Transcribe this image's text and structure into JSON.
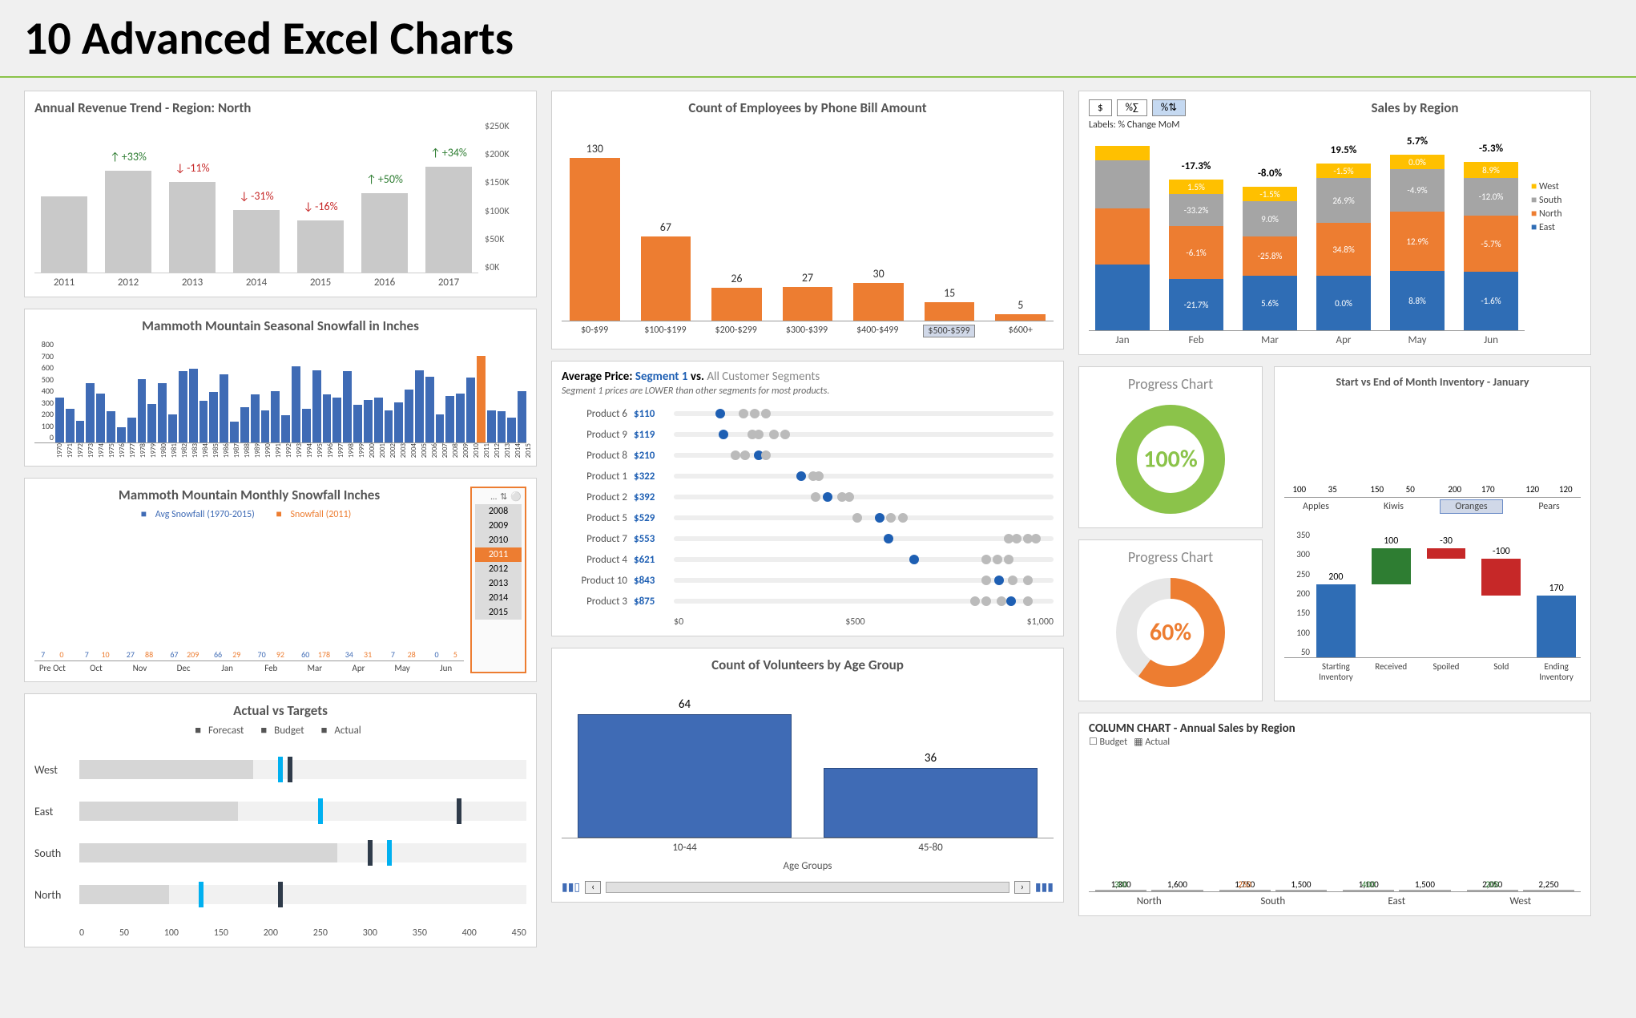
{
  "title": "10 Advanced Excel Charts",
  "chart_data": [
    {
      "id": "annual_revenue",
      "type": "bar",
      "title": "Annual Revenue Trend - Region: North",
      "categories": [
        "2011",
        "2012",
        "2013",
        "2014",
        "2015",
        "2016",
        "2017"
      ],
      "values": [
        150000,
        200000,
        178000,
        123000,
        103000,
        155000,
        208000
      ],
      "change_labels": [
        "",
        "+33%",
        "-11%",
        "-31%",
        "-16%",
        "+50%",
        "+34%"
      ],
      "ylim": [
        0,
        250000
      ],
      "yticks": [
        "$250K",
        "$200K",
        "$150K",
        "$100K",
        "$50K",
        "$0K"
      ]
    },
    {
      "id": "seasonal_snowfall",
      "type": "bar",
      "title": "Mammoth Mountain Seasonal Snowfall in Inches",
      "categories": [
        "1970",
        "1971",
        "1972",
        "1973",
        "1974",
        "1975",
        "1976",
        "1977",
        "1978",
        "1979",
        "1980",
        "1981",
        "1982",
        "1983",
        "1984",
        "1985",
        "1986",
        "1987",
        "1988",
        "1989",
        "1990",
        "1991",
        "1992",
        "1993",
        "1994",
        "1995",
        "1996",
        "1997",
        "1998",
        "1999",
        "2000",
        "2001",
        "2002",
        "2003",
        "2004",
        "2005",
        "2006",
        "2007",
        "2008",
        "2009",
        "2010",
        "2011",
        "2012",
        "2013",
        "2014",
        "2015"
      ],
      "values": [
        350,
        260,
        170,
        460,
        380,
        240,
        120,
        190,
        490,
        300,
        460,
        220,
        550,
        570,
        320,
        390,
        530,
        160,
        270,
        370,
        250,
        400,
        210,
        590,
        260,
        560,
        370,
        350,
        550,
        290,
        330,
        350,
        250,
        310,
        410,
        560,
        510,
        220,
        360,
        380,
        500,
        670,
        250,
        240,
        190,
        400
      ],
      "highlight_index": 41,
      "ylim": [
        0,
        800
      ],
      "yticks": [
        "800",
        "700",
        "600",
        "500",
        "400",
        "300",
        "200",
        "100",
        "0"
      ]
    },
    {
      "id": "monthly_snowfall",
      "type": "bar",
      "title": "Mammoth Mountain Monthly Snowfall Inches",
      "legend": [
        "Avg Snowfall (1970-2015)",
        "Snowfall (2011)"
      ],
      "categories": [
        "Pre Oct",
        "Oct",
        "Nov",
        "Dec",
        "Jan",
        "Feb",
        "Mar",
        "Apr",
        "May",
        "Jun"
      ],
      "series": [
        {
          "name": "Avg Snowfall (1970-2015)",
          "values": [
            7,
            7,
            27,
            67,
            66,
            70,
            60,
            34,
            7,
            0
          ]
        },
        {
          "name": "Snowfall (2011)",
          "values": [
            0,
            10,
            88,
            209,
            29,
            92,
            178,
            31,
            28,
            5
          ]
        }
      ],
      "slicer": {
        "years": [
          "2008",
          "2009",
          "2010",
          "2011",
          "2012",
          "2013",
          "2014",
          "2015"
        ],
        "selected": "2011",
        "icons": [
          "…",
          "⇅",
          "⚪"
        ]
      }
    },
    {
      "id": "actual_vs_targets",
      "type": "bullet",
      "title": "Actual vs Targets",
      "legend": [
        "Forecast",
        "Budget",
        "Actual"
      ],
      "categories": [
        "West",
        "East",
        "South",
        "North"
      ],
      "actual": [
        175,
        160,
        260,
        90
      ],
      "forecast": [
        200,
        240,
        310,
        120
      ],
      "budget": [
        210,
        380,
        290,
        200
      ],
      "xlim": [
        0,
        450
      ],
      "xticks": [
        "0",
        "50",
        "100",
        "150",
        "200",
        "250",
        "300",
        "350",
        "400",
        "450"
      ]
    },
    {
      "id": "phone_bill",
      "type": "bar",
      "title": "Count of Employees by Phone Bill Amount",
      "categories": [
        "$0-$99",
        "$100-$199",
        "$200-$299",
        "$300-$399",
        "$400-$499",
        "$500-$599",
        "$600+"
      ],
      "values": [
        130,
        67,
        26,
        27,
        30,
        15,
        5
      ],
      "selected_index": 5
    },
    {
      "id": "avg_price",
      "type": "dumbbell",
      "title_parts": [
        "Average Price: ",
        "Segment 1",
        " vs. ",
        "All Customer Segments"
      ],
      "subtitle": "Segment 1 prices are LOWER than other segments for most products.",
      "rows": [
        {
          "name": "Product 6",
          "value": 110,
          "s1": 110,
          "others": [
            170,
            200,
            230
          ]
        },
        {
          "name": "Product 9",
          "value": 119,
          "s1": 119,
          "others": [
            195,
            210,
            250,
            280
          ]
        },
        {
          "name": "Product 8",
          "value": 210,
          "s1": 210,
          "others": [
            150,
            175,
            230
          ]
        },
        {
          "name": "Product 1",
          "value": 322,
          "s1": 322,
          "others": [
            355,
            370
          ]
        },
        {
          "name": "Product 2",
          "value": 392,
          "s1": 392,
          "others": [
            360,
            430,
            450
          ]
        },
        {
          "name": "Product 5",
          "value": 529,
          "s1": 529,
          "others": [
            470,
            560,
            590
          ]
        },
        {
          "name": "Product 7",
          "value": 553,
          "s1": 553,
          "others": [
            870,
            890,
            920,
            940
          ]
        },
        {
          "name": "Product 4",
          "value": 621,
          "s1": 621,
          "others": [
            810,
            840,
            870
          ]
        },
        {
          "name": "Product 10",
          "value": 843,
          "s1": 843,
          "others": [
            810,
            880,
            920
          ]
        },
        {
          "name": "Product 3",
          "value": 875,
          "s1": 875,
          "others": [
            780,
            810,
            850,
            920
          ]
        }
      ],
      "xlim": [
        0,
        1000
      ],
      "xticks": [
        "$0",
        "$500",
        "$1,000"
      ]
    },
    {
      "id": "volunteers",
      "type": "bar",
      "title": "Count of Volunteers by Age Group",
      "categories": [
        "10-44",
        "45-80"
      ],
      "values": [
        64,
        36
      ],
      "xlabel": "Age Groups"
    },
    {
      "id": "sales_region",
      "type": "stacked_bar",
      "title": "Sales by Region",
      "buttons": [
        "$",
        "%∑",
        "%⇅"
      ],
      "button_selected": 2,
      "subtitle": "Labels: % Change MoM",
      "categories": [
        "Jan",
        "Feb",
        "Mar",
        "Apr",
        "May",
        "Jun"
      ],
      "legend": [
        "West",
        "South",
        "North",
        "East"
      ],
      "stacks": [
        {
          "total": "",
          "east": {
            "h": 82,
            "l": ""
          },
          "north": {
            "h": 70,
            "l": ""
          },
          "south": {
            "h": 60,
            "l": ""
          },
          "west": {
            "h": 18,
            "l": ""
          }
        },
        {
          "total": "-17.3%",
          "east": {
            "h": 64,
            "l": "-21.7%"
          },
          "north": {
            "h": 66,
            "l": "-6.1%"
          },
          "south": {
            "h": 40,
            "l": "-33.2%"
          },
          "west": {
            "h": 18,
            "l": "1.5%"
          }
        },
        {
          "total": "-8.0%",
          "east": {
            "h": 68,
            "l": "5.6%"
          },
          "north": {
            "h": 49,
            "l": "-25.8%"
          },
          "south": {
            "h": 44,
            "l": "9.0%"
          },
          "west": {
            "h": 18,
            "l": "-1.5%"
          }
        },
        {
          "total": "19.5%",
          "east": {
            "h": 68,
            "l": "0.0%"
          },
          "north": {
            "h": 66,
            "l": "34.8%"
          },
          "south": {
            "h": 56,
            "l": "26.9%"
          },
          "west": {
            "h": 18,
            "l": "-1.5%"
          }
        },
        {
          "total": "5.7%",
          "east": {
            "h": 74,
            "l": "8.8%"
          },
          "north": {
            "h": 74,
            "l": "12.9%"
          },
          "south": {
            "h": 53,
            "l": "-4.9%"
          },
          "west": {
            "h": 18,
            "l": "0.0%"
          }
        },
        {
          "total": "-5.3%",
          "east": {
            "h": 73,
            "l": "-1.6%"
          },
          "north": {
            "h": 70,
            "l": "-5.7%"
          },
          "south": {
            "h": 47,
            "l": "-12.0%"
          },
          "west": {
            "h": 20,
            "l": "8.9%"
          }
        }
      ]
    },
    {
      "id": "progress1",
      "type": "donut",
      "title": "Progress Chart",
      "value": 100,
      "label": "100%",
      "color": "#8bc34a"
    },
    {
      "id": "progress2",
      "type": "donut",
      "title": "Progress Chart",
      "value": 60,
      "label": "60%",
      "color": "#ed7d31"
    },
    {
      "id": "inventory",
      "type": "bar+waterfall",
      "title": "Start vs End of Month Inventory - January",
      "top": {
        "categories": [
          "Apples",
          "Kiwis",
          "Oranges",
          "Pears"
        ],
        "start": [
          100,
          150,
          200,
          120
        ],
        "end": [
          35,
          50,
          170,
          120
        ],
        "selected": "Oranges"
      },
      "waterfall": {
        "categories": [
          "Starting Inventory",
          "Received",
          "Spoiled",
          "Sold",
          "Ending Inventory"
        ],
        "values": [
          200,
          100,
          -30,
          -100,
          170
        ],
        "ylim": [
          0,
          350
        ],
        "yticks": [
          "350",
          "300",
          "250",
          "200",
          "150",
          "100",
          "50"
        ]
      }
    },
    {
      "id": "annual_sales",
      "type": "grouped_bar",
      "title": "COLUMN CHART - Annual Sales by Region",
      "legend": [
        "Budget",
        "Actual"
      ],
      "categories": [
        "North",
        "South",
        "East",
        "West"
      ],
      "budget": [
        1300,
        1750,
        1100,
        2050
      ],
      "actual": [
        1600,
        1500,
        1500,
        2250
      ],
      "diff": [
        300,
        250,
        400,
        200
      ],
      "diff_labels": [
        "300",
        "250",
        "400",
        "200"
      ],
      "budget_labels": [
        "1,300",
        "1,750",
        "1,100",
        "2,050"
      ],
      "actual_labels": [
        "1,600",
        "1,500",
        "1,500",
        "2,250"
      ]
    }
  ]
}
